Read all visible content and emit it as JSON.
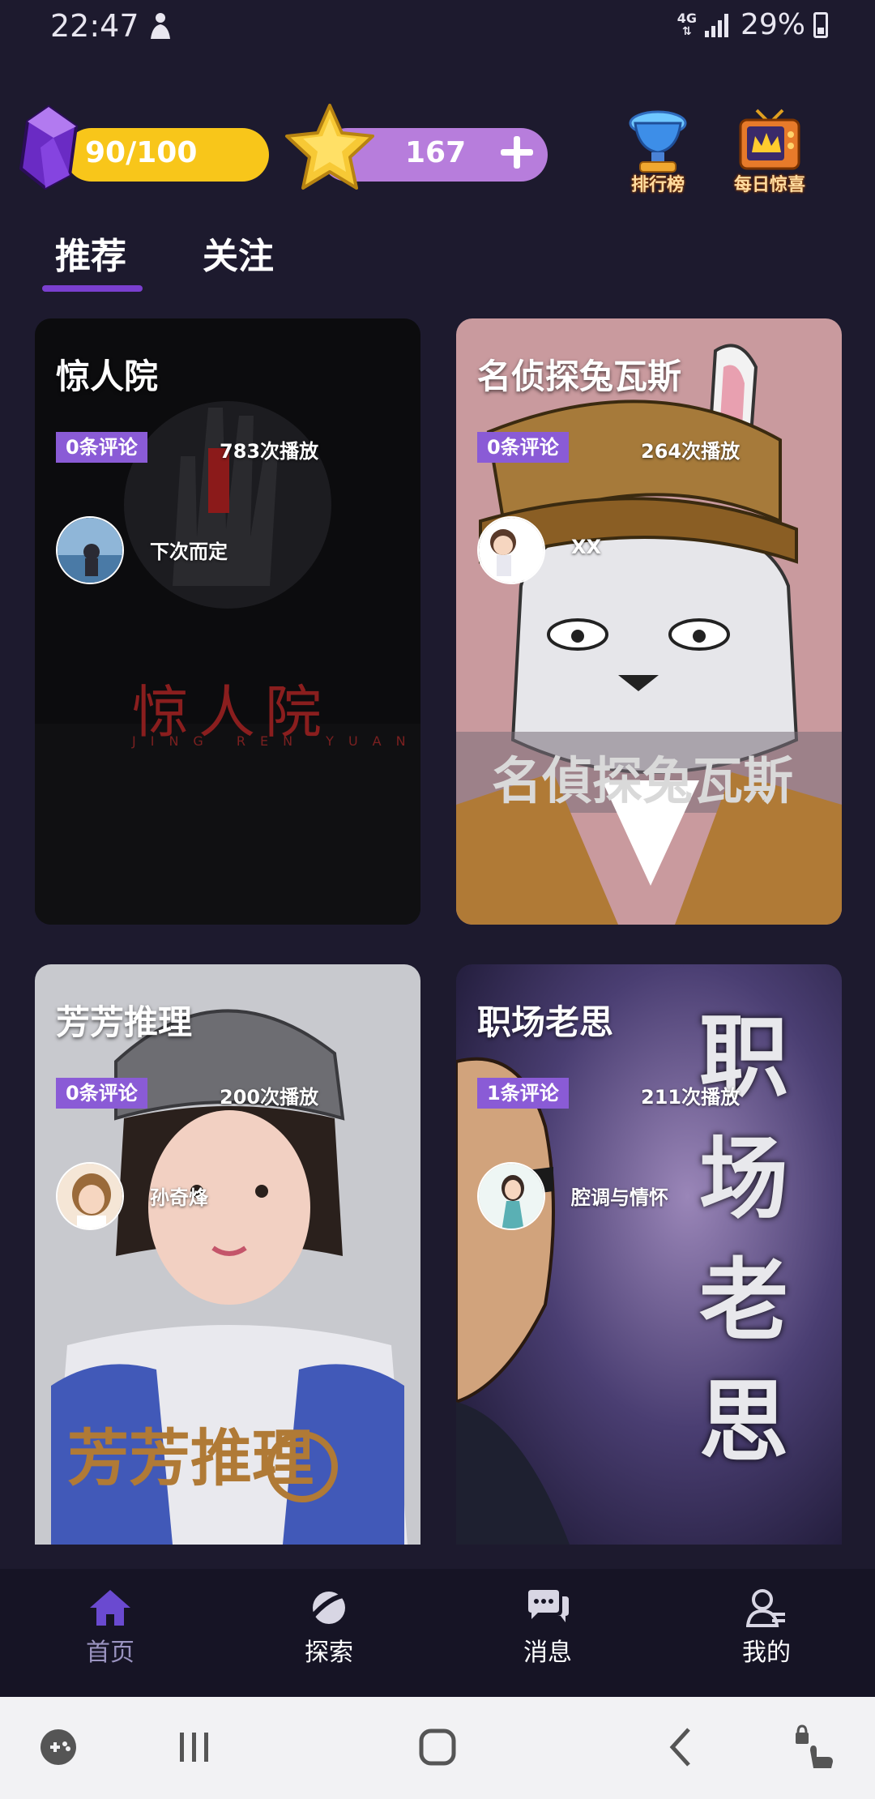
{
  "status_bar": {
    "time": "22:47",
    "network": "4G",
    "battery": "29%"
  },
  "resources": {
    "energy": "90/100",
    "energy_fill": 0.9,
    "coins": "167"
  },
  "header_icons": {
    "ranking_label": "排行榜",
    "daily_label": "每日惊喜"
  },
  "tabs": [
    {
      "label": "推荐",
      "active": true
    },
    {
      "label": "关注",
      "active": false
    }
  ],
  "cards": [
    {
      "title": "惊人院",
      "comments": "0条评论",
      "plays": "783次播放",
      "author": "下次而定",
      "poster_text": "惊人院",
      "poster_sub": "JING REN YUAN"
    },
    {
      "title": "名侦探兔瓦斯",
      "comments": "0条评论",
      "plays": "264次播放",
      "author": "XX",
      "poster_text": "名偵探兔瓦斯"
    },
    {
      "title": "芳芳推理",
      "comments": "0条评论",
      "plays": "200次播放",
      "author": "孙奇烽",
      "poster_text": "芳芳推理"
    },
    {
      "title": "职场老思",
      "comments": "1条评论",
      "plays": "211次播放",
      "author": "腔调与情怀",
      "poster_text": "职场老思"
    }
  ],
  "bottom_nav": [
    {
      "label": "首页",
      "icon": "home-icon",
      "active": true
    },
    {
      "label": "探索",
      "icon": "planet-icon",
      "active": false
    },
    {
      "label": "消息",
      "icon": "chat-icon",
      "active": false
    },
    {
      "label": "我的",
      "icon": "profile-icon",
      "active": false
    }
  ],
  "colors": {
    "background": "#1d1a2e",
    "accent": "#7a3fcf",
    "energy": "#f8c61a",
    "coin": "#b77ddc",
    "badge": "#8a5bd6"
  }
}
